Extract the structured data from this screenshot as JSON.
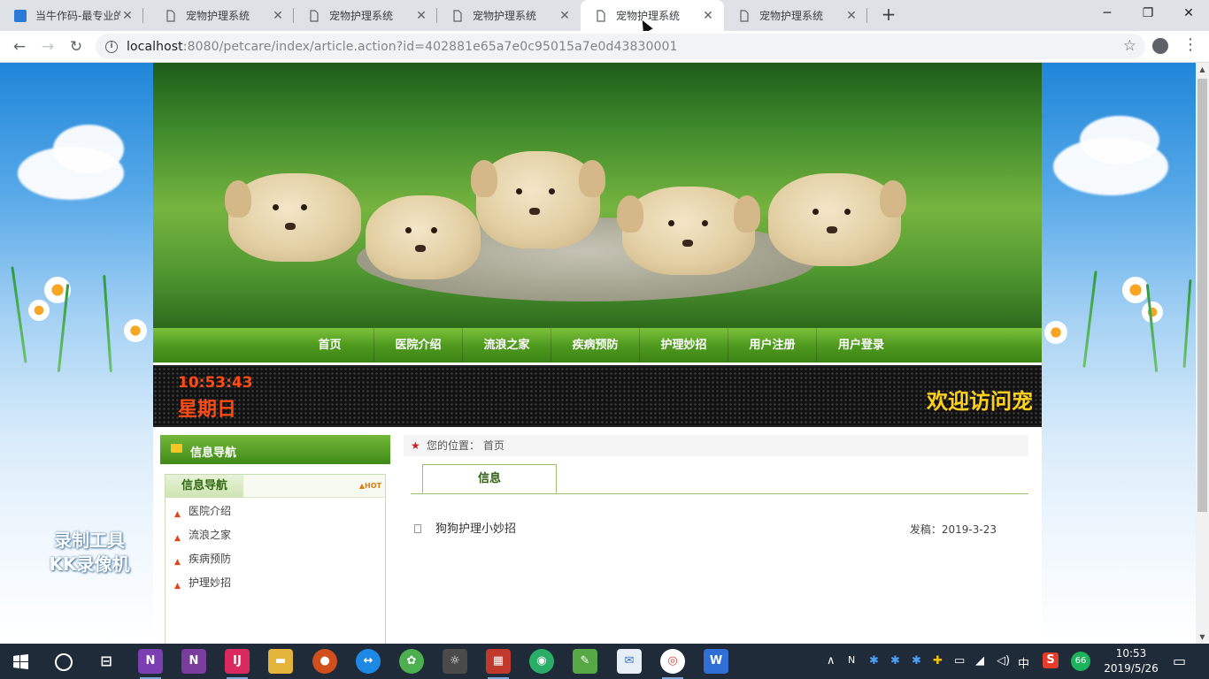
{
  "browser": {
    "tabs": [
      {
        "title": "当牛作码-最专业的",
        "active": false
      },
      {
        "title": "宠物护理系统",
        "active": false
      },
      {
        "title": "宠物护理系统",
        "active": false
      },
      {
        "title": "宠物护理系统",
        "active": false
      },
      {
        "title": "宠物护理系统",
        "active": true
      },
      {
        "title": "宠物护理系统",
        "active": false
      }
    ],
    "url_host": "localhost",
    "url_rest": ":8080/petcare/index/article.action?id=402881e65a7e0c95015a7e0d43830001"
  },
  "site": {
    "nav": [
      "首页",
      "医院介绍",
      "流浪之家",
      "疾病预防",
      "护理妙招",
      "用户注册",
      "用户登录"
    ],
    "led_time": "10:53:43",
    "led_day": "星期日",
    "led_marquee": "欢迎访问宠",
    "sidebar": {
      "header": "信息导航",
      "tab": "信息导航",
      "hot": "HOT",
      "links": [
        "医院介绍",
        "流浪之家",
        "疾病预防",
        "护理妙招"
      ]
    },
    "breadcrumb": {
      "label": "您的位置：",
      "current": "首页"
    },
    "content_tab": "信息",
    "articles": [
      {
        "title": "狗狗护理小妙招",
        "date": "发稿：2019-3-23"
      }
    ]
  },
  "watermark": {
    "line1": "录制工具",
    "line2": "KK录像机"
  },
  "taskbar": {
    "ime": "中",
    "badge": "66",
    "time": "10:53",
    "date": "2019/5/26"
  }
}
